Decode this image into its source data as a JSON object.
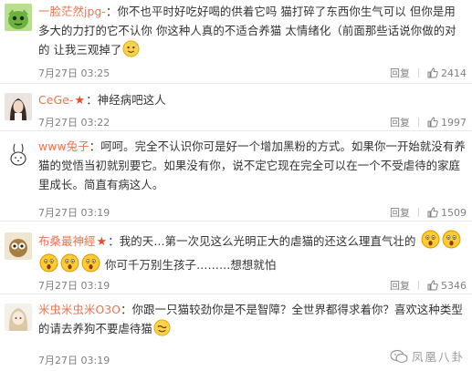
{
  "comments": [
    {
      "username": "一脸茫然jpg-",
      "vip": false,
      "text": "你不也平时好吃好喝的供着它吗  猫打碎了东西你生气可以  但你是用多大的力打的它不认你   你这种人真的不适合养猫   太情绪化（前面那些话说你做的对的  让我三观掉了",
      "trailing_emojis": [
        "sweat-smile-emoji"
      ],
      "time": "7月27日 03:25",
      "reply_label": "回复",
      "likes": "2414",
      "avatar": "green-cartoon-avatar"
    },
    {
      "username": "CeGe-",
      "vip": true,
      "text": "神经病吧这人",
      "trailing_emojis": [],
      "time": "7月27日 03:22",
      "reply_label": "回复",
      "likes": "1997",
      "avatar": "girl-photo-avatar"
    },
    {
      "username": "www兔子",
      "vip": false,
      "text": "呵呵。完全不认识你可是好一个增加黑粉的方式。如果你一开始就没有养猫的觉悟当初就别要它。如果没有你，说不定它现在完全可以在一个不受虐待的家庭里成长。简直有病这人。",
      "trailing_emojis": [],
      "time": "7月27日 03:19",
      "reply_label": "回复",
      "likes": "1509",
      "avatar": "rabbit-sketch-avatar"
    },
    {
      "username": "布桑最神經",
      "vip": true,
      "text_a": "我的天…第一次见这么光明正大的虐猫的还这么理直气壮的",
      "emojis_a": [
        "shocked-emoji",
        "shocked-emoji"
      ],
      "emojis_b": [
        "shocked-emoji",
        "shocked-emoji",
        "shocked-emoji"
      ],
      "text_b": " 你可千万别生孩子………想想就怕",
      "time": "7月27日 03:19",
      "reply_label": "回复",
      "likes": "5346",
      "avatar": "owl-avatar"
    },
    {
      "username": "米虫米虫米O3O",
      "vip": false,
      "text": "你跟一只猫较劲你是不是智障？全世界都得求着你？喜欢这种类型的请去养狗不要虐待猫",
      "trailing_emojis": [
        "wave-emoji"
      ],
      "time": "7月27日 03:19",
      "reply_label": "回复",
      "likes": "",
      "avatar": "anime-girl-avatar"
    }
  ],
  "watermark": "凤凰八卦",
  "colors": {
    "username": "#eb7350",
    "vip_star": "#f04a2c",
    "meta": "#808080",
    "text": "#333333"
  }
}
